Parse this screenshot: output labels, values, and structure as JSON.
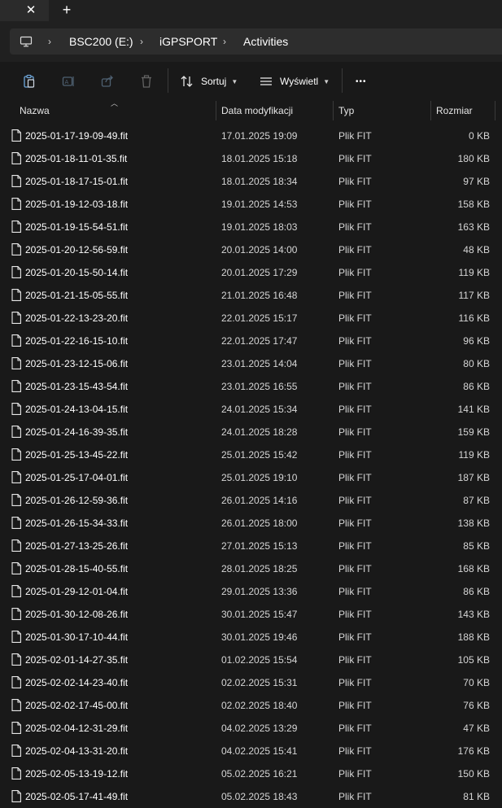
{
  "tabbar": {
    "close_glyph": "✕",
    "new_tab_glyph": "+"
  },
  "address": {
    "root_icon": "computer-icon",
    "crumbs": [
      "BSC200 (E:)",
      "iGPSPORT",
      "Activities"
    ],
    "separator_glyph": "›"
  },
  "toolbar": {
    "icons": [
      "paste-icon",
      "rename-icon",
      "share-icon",
      "delete-icon"
    ],
    "sort_label": "Sortuj",
    "view_label": "Wyświetl",
    "more_glyph": "•••"
  },
  "columns": {
    "name": "Nazwa",
    "date": "Data modyfikacji",
    "type": "Typ",
    "size": "Rozmiar"
  },
  "files": [
    {
      "name": "2025-01-17-19-09-49.fit",
      "date": "17.01.2025 19:09",
      "type": "Plik FIT",
      "size": "0 KB"
    },
    {
      "name": "2025-01-18-11-01-35.fit",
      "date": "18.01.2025 15:18",
      "type": "Plik FIT",
      "size": "180 KB"
    },
    {
      "name": "2025-01-18-17-15-01.fit",
      "date": "18.01.2025 18:34",
      "type": "Plik FIT",
      "size": "97 KB"
    },
    {
      "name": "2025-01-19-12-03-18.fit",
      "date": "19.01.2025 14:53",
      "type": "Plik FIT",
      "size": "158 KB"
    },
    {
      "name": "2025-01-19-15-54-51.fit",
      "date": "19.01.2025 18:03",
      "type": "Plik FIT",
      "size": "163 KB"
    },
    {
      "name": "2025-01-20-12-56-59.fit",
      "date": "20.01.2025 14:00",
      "type": "Plik FIT",
      "size": "48 KB"
    },
    {
      "name": "2025-01-20-15-50-14.fit",
      "date": "20.01.2025 17:29",
      "type": "Plik FIT",
      "size": "119 KB"
    },
    {
      "name": "2025-01-21-15-05-55.fit",
      "date": "21.01.2025 16:48",
      "type": "Plik FIT",
      "size": "117 KB"
    },
    {
      "name": "2025-01-22-13-23-20.fit",
      "date": "22.01.2025 15:17",
      "type": "Plik FIT",
      "size": "116 KB"
    },
    {
      "name": "2025-01-22-16-15-10.fit",
      "date": "22.01.2025 17:47",
      "type": "Plik FIT",
      "size": "96 KB"
    },
    {
      "name": "2025-01-23-12-15-06.fit",
      "date": "23.01.2025 14:04",
      "type": "Plik FIT",
      "size": "80 KB"
    },
    {
      "name": "2025-01-23-15-43-54.fit",
      "date": "23.01.2025 16:55",
      "type": "Plik FIT",
      "size": "86 KB"
    },
    {
      "name": "2025-01-24-13-04-15.fit",
      "date": "24.01.2025 15:34",
      "type": "Plik FIT",
      "size": "141 KB"
    },
    {
      "name": "2025-01-24-16-39-35.fit",
      "date": "24.01.2025 18:28",
      "type": "Plik FIT",
      "size": "159 KB"
    },
    {
      "name": "2025-01-25-13-45-22.fit",
      "date": "25.01.2025 15:42",
      "type": "Plik FIT",
      "size": "119 KB"
    },
    {
      "name": "2025-01-25-17-04-01.fit",
      "date": "25.01.2025 19:10",
      "type": "Plik FIT",
      "size": "187 KB"
    },
    {
      "name": "2025-01-26-12-59-36.fit",
      "date": "26.01.2025 14:16",
      "type": "Plik FIT",
      "size": "87 KB"
    },
    {
      "name": "2025-01-26-15-34-33.fit",
      "date": "26.01.2025 18:00",
      "type": "Plik FIT",
      "size": "138 KB"
    },
    {
      "name": "2025-01-27-13-25-26.fit",
      "date": "27.01.2025 15:13",
      "type": "Plik FIT",
      "size": "85 KB"
    },
    {
      "name": "2025-01-28-15-40-55.fit",
      "date": "28.01.2025 18:25",
      "type": "Plik FIT",
      "size": "168 KB"
    },
    {
      "name": "2025-01-29-12-01-04.fit",
      "date": "29.01.2025 13:36",
      "type": "Plik FIT",
      "size": "86 KB"
    },
    {
      "name": "2025-01-30-12-08-26.fit",
      "date": "30.01.2025 15:47",
      "type": "Plik FIT",
      "size": "143 KB"
    },
    {
      "name": "2025-01-30-17-10-44.fit",
      "date": "30.01.2025 19:46",
      "type": "Plik FIT",
      "size": "188 KB"
    },
    {
      "name": "2025-02-01-14-27-35.fit",
      "date": "01.02.2025 15:54",
      "type": "Plik FIT",
      "size": "105 KB"
    },
    {
      "name": "2025-02-02-14-23-40.fit",
      "date": "02.02.2025 15:31",
      "type": "Plik FIT",
      "size": "70 KB"
    },
    {
      "name": "2025-02-02-17-45-00.fit",
      "date": "02.02.2025 18:40",
      "type": "Plik FIT",
      "size": "76 KB"
    },
    {
      "name": "2025-02-04-12-31-29.fit",
      "date": "04.02.2025 13:29",
      "type": "Plik FIT",
      "size": "47 KB"
    },
    {
      "name": "2025-02-04-13-31-20.fit",
      "date": "04.02.2025 15:41",
      "type": "Plik FIT",
      "size": "176 KB"
    },
    {
      "name": "2025-02-05-13-19-12.fit",
      "date": "05.02.2025 16:21",
      "type": "Plik FIT",
      "size": "150 KB"
    },
    {
      "name": "2025-02-05-17-41-49.fit",
      "date": "05.02.2025 18:43",
      "type": "Plik FIT",
      "size": "81 KB"
    }
  ]
}
